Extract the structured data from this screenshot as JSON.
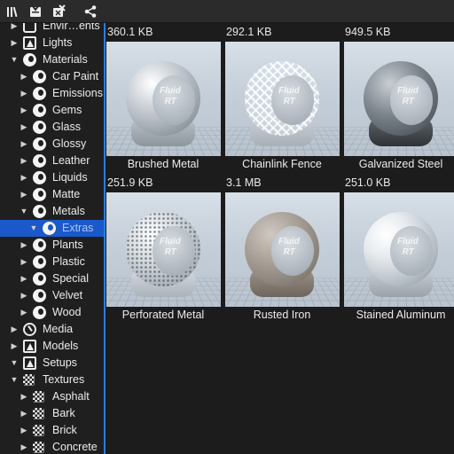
{
  "tree": {
    "items": [
      {
        "label": "Envir…ents",
        "expander": "▶",
        "icon": "environment-icon",
        "level": 1
      },
      {
        "label": "Lights",
        "expander": "▶",
        "icon": "lights-icon",
        "level": 1
      },
      {
        "label": "Materials",
        "expander": "▼",
        "icon": "material-ball-icon",
        "level": 1
      },
      {
        "label": "Car Paint",
        "expander": "▶",
        "icon": "material-ball-icon",
        "level": 2
      },
      {
        "label": "Emissions",
        "expander": "▶",
        "icon": "material-ball-icon",
        "level": 2
      },
      {
        "label": "Gems",
        "expander": "▶",
        "icon": "material-ball-icon",
        "level": 2
      },
      {
        "label": "Glass",
        "expander": "▶",
        "icon": "material-ball-icon",
        "level": 2
      },
      {
        "label": "Glossy",
        "expander": "▶",
        "icon": "material-ball-icon",
        "level": 2
      },
      {
        "label": "Leather",
        "expander": "▶",
        "icon": "material-ball-icon",
        "level": 2
      },
      {
        "label": "Liquids",
        "expander": "▶",
        "icon": "material-ball-icon",
        "level": 2
      },
      {
        "label": "Matte",
        "expander": "▶",
        "icon": "material-ball-icon",
        "level": 2
      },
      {
        "label": "Metals",
        "expander": "▼",
        "icon": "material-ball-icon",
        "level": 2
      },
      {
        "label": "Extras",
        "expander": "▼",
        "icon": "material-ball-icon",
        "level": 3,
        "selected": true
      },
      {
        "label": "Plants",
        "expander": "▶",
        "icon": "material-ball-icon",
        "level": 2
      },
      {
        "label": "Plastic",
        "expander": "▶",
        "icon": "material-ball-icon",
        "level": 2
      },
      {
        "label": "Special",
        "expander": "▶",
        "icon": "material-ball-icon",
        "level": 2
      },
      {
        "label": "Velvet",
        "expander": "▶",
        "icon": "material-ball-icon",
        "level": 2
      },
      {
        "label": "Wood",
        "expander": "▶",
        "icon": "material-ball-icon",
        "level": 2
      },
      {
        "label": "Media",
        "expander": "▶",
        "icon": "media-icon",
        "level": 1
      },
      {
        "label": "Models",
        "expander": "▶",
        "icon": "lights-icon",
        "level": 1
      },
      {
        "label": "Setups",
        "expander": "▼",
        "icon": "lights-icon",
        "level": 1
      },
      {
        "label": "Textures",
        "expander": "▼",
        "icon": "checker-icon",
        "level": 1
      },
      {
        "label": "Asphalt",
        "expander": "▶",
        "icon": "checker-icon",
        "level": 2
      },
      {
        "label": "Bark",
        "expander": "▶",
        "icon": "checker-icon",
        "level": 2
      },
      {
        "label": "Brick",
        "expander": "▶",
        "icon": "checker-icon",
        "level": 2
      },
      {
        "label": "Concrete",
        "expander": "▶",
        "icon": "checker-icon",
        "level": 2
      }
    ]
  },
  "toolbar": {
    "buttons": [
      "library-icon",
      "import-icon",
      "remove-icon",
      "share-icon"
    ]
  },
  "materials": [
    {
      "size": "360.1 KB",
      "name": "Brushed Metal",
      "style": "brushed"
    },
    {
      "size": "292.1 KB",
      "name": "Chainlink Fence",
      "style": "chainlink"
    },
    {
      "size": "949.5 KB",
      "name": "Galvanized Steel",
      "style": "galvanized"
    },
    {
      "size": "251.9 KB",
      "name": "Perforated Metal",
      "style": "perforated"
    },
    {
      "size": "3.1 MB",
      "name": "Rusted Iron",
      "style": "rusted"
    },
    {
      "size": "251.0 KB",
      "name": "Stained Aluminum",
      "style": "stained"
    }
  ],
  "thumb_logo": [
    "Fluid",
    "RT"
  ],
  "colors": {
    "selection": "#1b58c9",
    "panel_border": "#2f7bd8"
  }
}
